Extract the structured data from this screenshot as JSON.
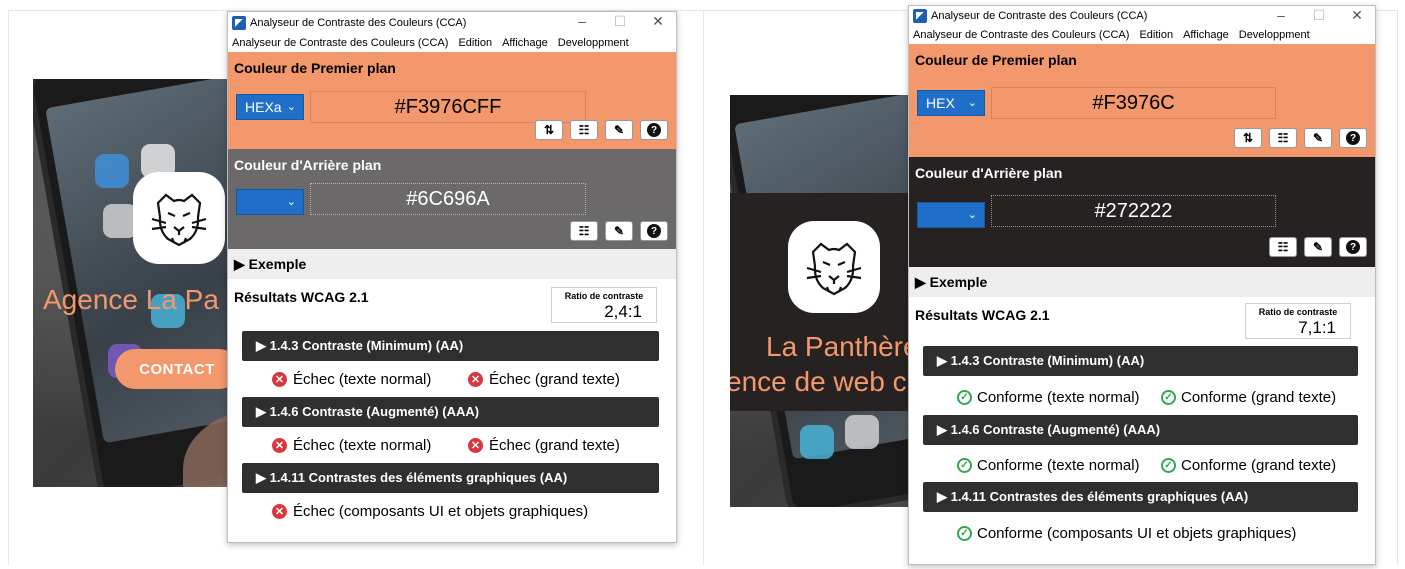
{
  "colors": {
    "foreground": "#F3976C",
    "background_left": "#6C696A",
    "background_right": "#272222",
    "select_blue": "#1F6FC9",
    "criterion_bg": "#2F2F2F",
    "fail_red": "#D9363E",
    "pass_green": "#2FA84F"
  },
  "left": {
    "site": {
      "heading": "Agence La Pa",
      "contact_label": "CONTACT"
    },
    "window": {
      "title": "Analyseur de Contraste des Couleurs (CCA)",
      "controls": {
        "minimize": "–",
        "maximize": "☐",
        "close": "✕"
      },
      "menu": [
        "Analyseur de Contraste des Couleurs (CCA)",
        "Edition",
        "Affichage",
        "Developpment"
      ],
      "foreground": {
        "title": "Couleur de Premier plan",
        "format": "HEXa",
        "value": "#F3976CFF"
      },
      "background": {
        "title": "Couleur d'Arrière plan",
        "format": "",
        "value": "#6C696A"
      },
      "example_label": "▶ Exemple",
      "results": {
        "title": "Résultats WCAG 2.1",
        "ratio_label": "Ratio de contraste",
        "ratio_value": "2,4:1",
        "criteria": [
          {
            "label": "▶  1.4.3 Contraste (Minimum) (AA)",
            "results": [
              "Échec (texte normal)",
              "Échec (grand texte)"
            ]
          },
          {
            "label": "▶  1.4.6 Contraste (Augmenté) (AAA)",
            "results": [
              "Échec (texte normal)",
              "Échec (grand texte)"
            ]
          },
          {
            "label": "▶  1.4.11 Contrastes des éléments graphiques (AA)",
            "results": [
              "Échec (composants UI et objets graphiques)"
            ]
          }
        ]
      }
    }
  },
  "right": {
    "site": {
      "heading_line1": "La Panthère",
      "heading_line2": "ence de web c"
    },
    "window": {
      "title": "Analyseur de Contraste des Couleurs (CCA)",
      "controls": {
        "minimize": "–",
        "maximize": "☐",
        "close": "✕"
      },
      "menu": [
        "Analyseur de Contraste des Couleurs (CCA)",
        "Edition",
        "Affichage",
        "Developpment"
      ],
      "foreground": {
        "title": "Couleur de Premier plan",
        "format": "HEX",
        "value": "#F3976C"
      },
      "background": {
        "title": "Couleur d'Arrière plan",
        "format": "",
        "value": "#272222"
      },
      "example_label": "▶ Exemple",
      "results": {
        "title": "Résultats WCAG 2.1",
        "ratio_label": "Ratio de contraste",
        "ratio_value": "7,1:1",
        "criteria": [
          {
            "label": "▶  1.4.3 Contraste (Minimum) (AA)",
            "results": [
              "Conforme (texte normal)",
              "Conforme (grand texte)"
            ]
          },
          {
            "label": "▶  1.4.6 Contraste (Augmenté) (AAA)",
            "results": [
              "Conforme (texte normal)",
              "Conforme (grand texte)"
            ]
          },
          {
            "label": "▶  1.4.11 Contrastes des éléments graphiques (AA)",
            "results": [
              "Conforme (composants UI et objets graphiques)"
            ]
          }
        ]
      }
    }
  },
  "icons": {
    "swap": "swap-icon",
    "sliders": "sliders-icon",
    "eyedropper": "eyedropper-icon",
    "help": "help-icon",
    "fail": "error-circle-icon",
    "pass": "check-circle-icon",
    "logo": "panther-logo-icon"
  }
}
